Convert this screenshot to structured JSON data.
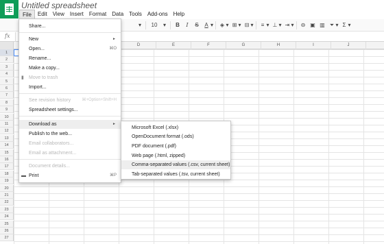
{
  "app": {
    "doc_title": "Untitled spreadsheet"
  },
  "menubar": [
    {
      "label": "File",
      "active": true
    },
    {
      "label": "Edit"
    },
    {
      "label": "View"
    },
    {
      "label": "Insert"
    },
    {
      "label": "Format"
    },
    {
      "label": "Data"
    },
    {
      "label": "Tools"
    },
    {
      "label": "Add-ons"
    },
    {
      "label": "Help"
    }
  ],
  "toolbar": {
    "font_size": "10",
    "bold": "B",
    "italic": "I",
    "strike": "S",
    "text_color": "A"
  },
  "formula_bar": {
    "fx": "fx"
  },
  "grid": {
    "columns": [
      "D",
      "E",
      "F",
      "G",
      "H",
      "I",
      "J"
    ],
    "rows": [
      "1",
      "2",
      "3",
      "4",
      "5",
      "6",
      "7",
      "8",
      "9",
      "10",
      "11",
      "12",
      "13",
      "14",
      "15",
      "16",
      "17",
      "18",
      "19",
      "20",
      "21",
      "22",
      "23",
      "24",
      "25",
      "26",
      "27"
    ]
  },
  "file_menu": {
    "share": "Share...",
    "new": "New",
    "open": "Open...",
    "open_shortcut": "⌘O",
    "rename": "Rename...",
    "make_copy": "Make a copy...",
    "move_trash": "Move to trash",
    "import": "Import...",
    "revision_history": "See revision history",
    "revision_shortcut": "⌘+Option+Shift+H",
    "spreadsheet_settings": "Spreadsheet settings...",
    "download_as": "Download as",
    "publish": "Publish to the web...",
    "email_collab": "Email collaborators...",
    "email_attach": "Email as attachment...",
    "doc_details": "Document details...",
    "print": "Print",
    "print_shortcut": "⌘P"
  },
  "download_menu": [
    "Microsoft Excel (.xlsx)",
    "OpenDocument format (.ods)",
    "PDF document (.pdf)",
    "Web page (.html, zipped)",
    "Comma-separated values (.csv, current sheet)",
    "Tab-separated values (.tsv, current sheet)"
  ],
  "colors": {
    "brand_green": "#0f9d58",
    "selection_blue": "#4d90fe",
    "menu_highlight": "#eeeeee"
  }
}
